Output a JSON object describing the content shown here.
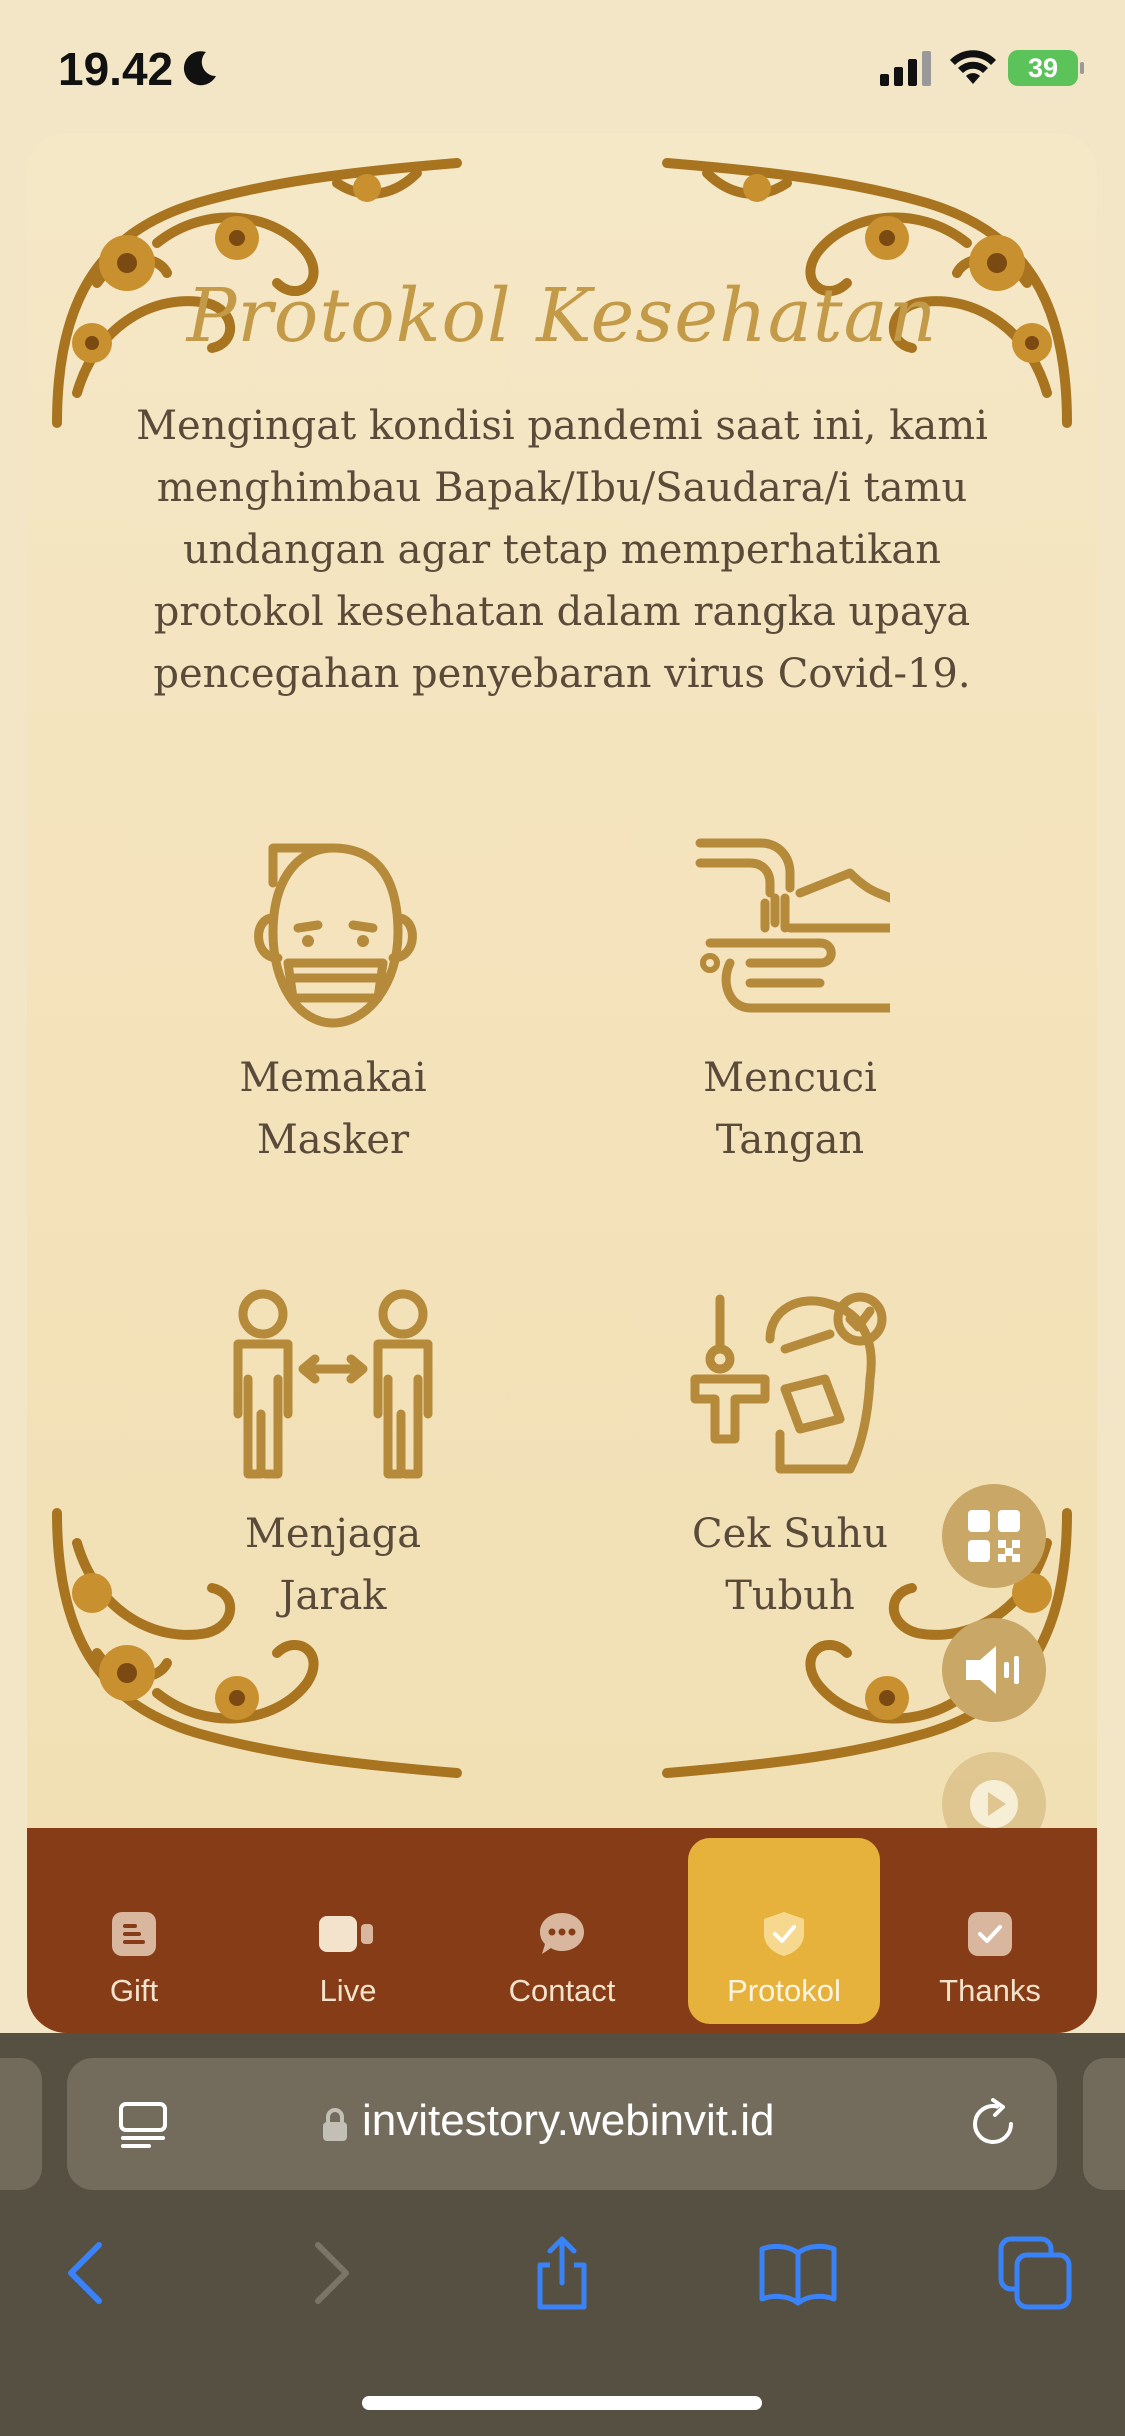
{
  "status_bar": {
    "time": "19.42",
    "battery": "39"
  },
  "page": {
    "title": "Protokol Kesehatan",
    "intro": "Mengingat kondisi pandemi saat ini, kami menghimbau Bapak/Ibu/Saudara/i tamu undangan agar tetap memperhatikan protokol kesehatan dalam rangka upaya pencegahan penyebaran virus Covid-19.",
    "protocols": [
      {
        "line1": "Memakai",
        "line2": "Masker",
        "icon": "mask-icon"
      },
      {
        "line1": "Mencuci",
        "line2": "Tangan",
        "icon": "hand-wash-icon"
      },
      {
        "line1": "Menjaga",
        "line2": "Jarak",
        "icon": "distance-icon"
      },
      {
        "line1": "Cek Suhu",
        "line2": "Tubuh",
        "icon": "thermometer-icon"
      }
    ]
  },
  "bottom_nav": {
    "items": [
      {
        "label": "Gift",
        "icon": "gift-icon"
      },
      {
        "label": "Live",
        "icon": "video-icon"
      },
      {
        "label": "Contact",
        "icon": "chat-icon"
      },
      {
        "label": "Protokol",
        "icon": "shield-icon"
      },
      {
        "label": "Thanks",
        "icon": "check-icon"
      }
    ],
    "active": "Protokol"
  },
  "browser": {
    "url": "invitestory.webinvit.id"
  },
  "colors": {
    "accent_gold": "#c39a48",
    "nav_brown": "#853c17",
    "active_tab": "#e6b23c",
    "ios_blue": "#3a82f7"
  }
}
